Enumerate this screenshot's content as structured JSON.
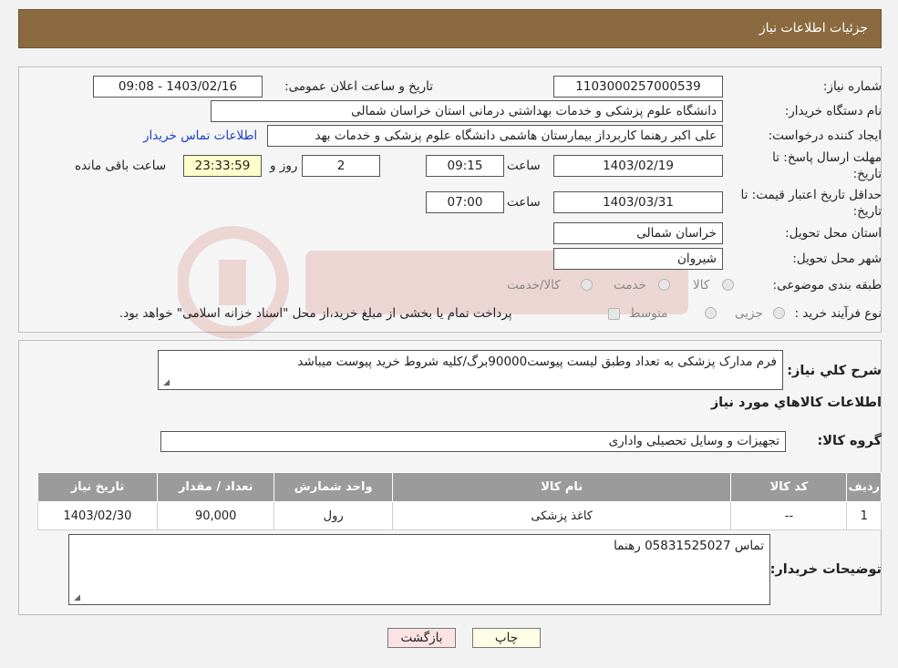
{
  "header": {
    "title": "جزئیات اطلاعات نیاز"
  },
  "form": {
    "need_number_label": "شماره نیاز:",
    "need_number": "1103000257000539",
    "announce_label": "تاریخ و ساعت اعلان عمومی:",
    "announce_value": "1403/02/16 - 09:08",
    "buyer_org_label": "نام دستگاه خریدار:",
    "buyer_org": "دانشگاه علوم پزشکی و خدمات بهداشتی درمانی استان خراسان شمالی",
    "creator_label": "ایجاد کننده درخواست:",
    "creator": "علی اکبر رهنما کاربرداز بیمارستان هاشمی دانشگاه علوم پزشکی و خدمات بهد",
    "contact_link": "اطلاعات تماس خریدار",
    "deadline_label_1": "مهلت ارسال پاسخ: تا",
    "deadline_label_2": "تاریخ:",
    "deadline_date": "1403/02/19",
    "time_label": "ساعت",
    "deadline_time": "09:15",
    "days_value": "2",
    "days_label": "روز و",
    "remaining_value": "23:33:59",
    "remaining_label": "ساعت باقی مانده",
    "validity_label_1": "حداقل تاریخ اعتبار قیمت: تا",
    "validity_label_2": "تاریخ:",
    "validity_date": "1403/03/31",
    "validity_time_label": "ساعت",
    "validity_time": "07:00",
    "province_label": "استان محل تحویل:",
    "province": "خراسان شمالی",
    "city_label": "شهر محل تحویل:",
    "city": "شیروان",
    "category_label": "طبقه بندی موضوعی:",
    "category_options": [
      "کالا",
      "خدمت",
      "کالا/خدمت"
    ],
    "process_label": "نوع فرآیند خرید :",
    "process_options": [
      "جزیی",
      "متوسط"
    ],
    "process_note": "پرداخت تمام یا بخشی از مبلغ خرید،از محل \"اسناد خزانه اسلامی\" خواهد بود."
  },
  "details": {
    "general_desc_label": "شرح کلي نياز:",
    "general_desc": "فرم مدارک پزشکی به تعداد وطبق لیست پیوست90000برگ/کلیه شروط خرید پیوست میباشد",
    "goods_info_title": "اطلاعات کالاهاي مورد نياز",
    "goods_group_label": "گروه کالا:",
    "goods_group": "تجهیزات و وسایل تحصیلی واداری",
    "table": {
      "headers": [
        "رديف",
        "کد کالا",
        "نام کالا",
        "واحد شمارش",
        "تعداد / مقدار",
        "تاریخ نیاز"
      ],
      "rows": [
        [
          "1",
          "--",
          "کاغذ پزشکی",
          "رول",
          "90,000",
          "1403/02/30"
        ]
      ]
    },
    "buyer_notes_label": "توضیحات خریدار:",
    "buyer_notes": "تماس 05831525027 رهنما"
  },
  "buttons": {
    "print": "چاپ",
    "back": "بازگشت"
  }
}
